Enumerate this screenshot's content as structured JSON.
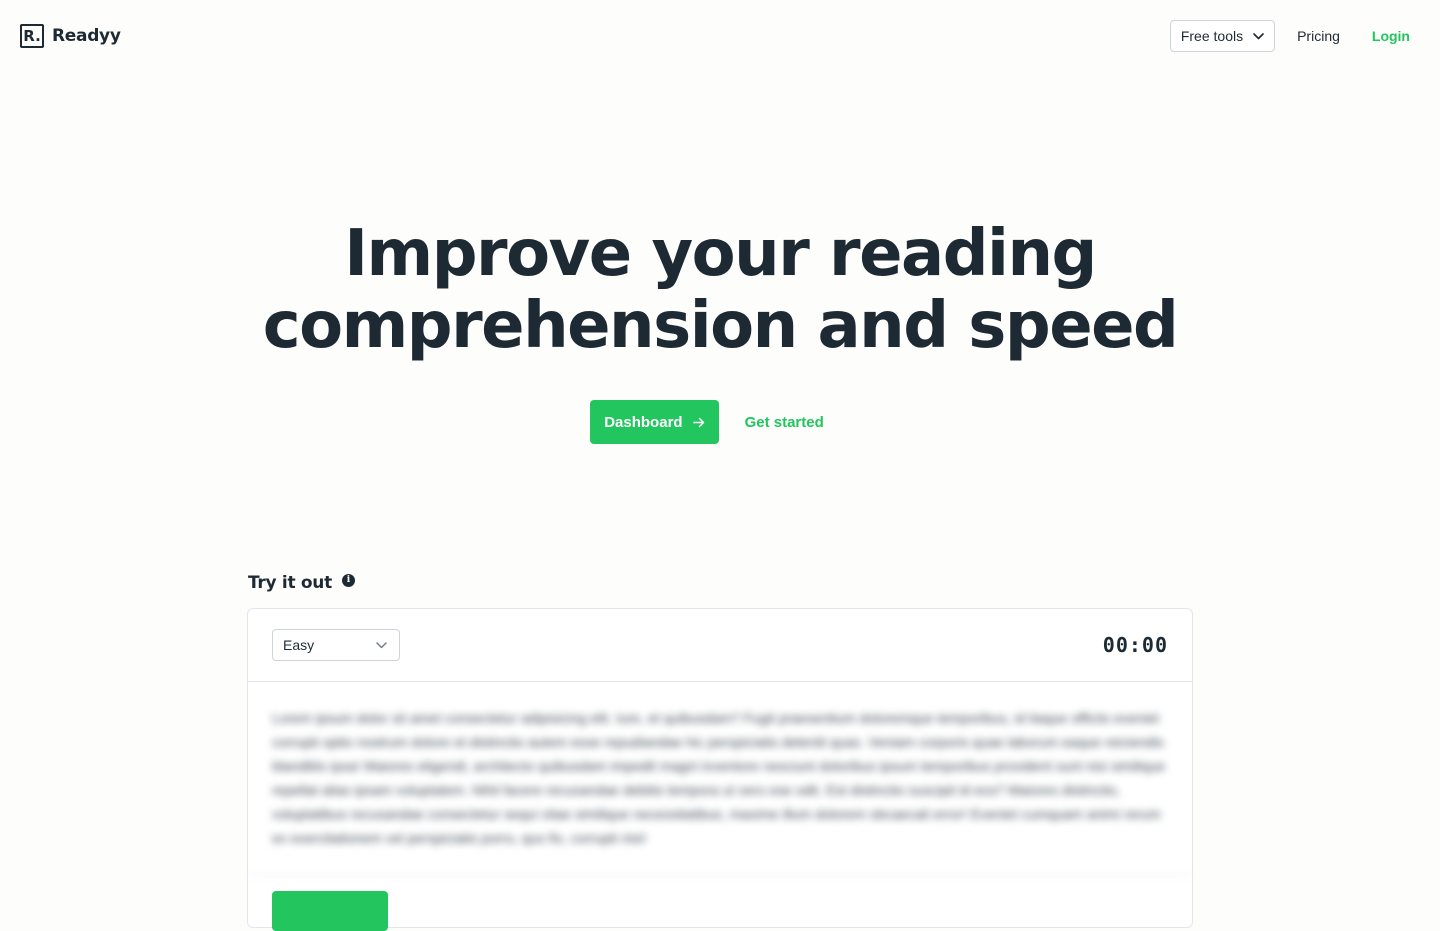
{
  "header": {
    "logo_mark": "R.",
    "logo_text": "Readyy",
    "free_tools_label": "Free tools",
    "pricing_label": "Pricing",
    "login_label": "Login"
  },
  "hero": {
    "title_line1": "Improve your reading",
    "title_line2": "comprehension and speed",
    "dashboard_label": "Dashboard",
    "get_started_label": "Get started"
  },
  "try_it_out": {
    "heading": "Try it out",
    "info_glyph": "i",
    "difficulty_selected": "Easy",
    "timer": "00:00",
    "passage": "Lorem ipsum dolor sit amet consectetur adipisicing elit. Iure, et quibusdam? Fugit praesentium doloremque temporibus, id itaque officiis eveniet corrupti optio nostrum dolore et distinctio autem esse repudiandae hic perspiciatis deleniti quas. Veniam corporis quae laborum eaque reiciendis blanditiis ipsa! Maiores eligendi, architecto quibusdam impedit magni inventore nesciunt doloribus ipsum temporibus provident sunt nisi similique repellat alias ipsam voluptatem. Nihil facere recusandae debitis tempora ut vero ese odit. Est distinctio suscipit id eos? Maiores distinctio, voluptatibus recusandae consectetur sequi vitae similique necessitatibus, maxime illum dolorem obcaecati error! Eveniet cumquam animi rerum ex exercitationem vel perspiciatis porro, quo fix, corrupti nisi!"
  },
  "colors": {
    "accent": "#22c55e",
    "text": "#1e2a33",
    "background": "#fdfdfb"
  }
}
